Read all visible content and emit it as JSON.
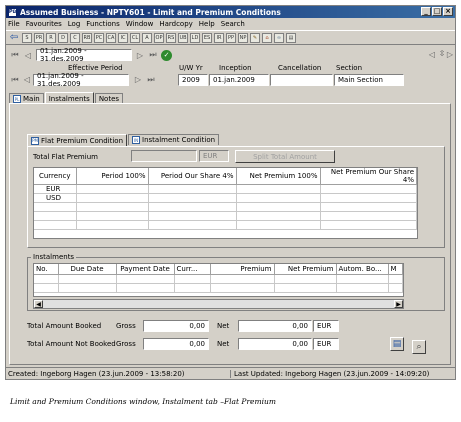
{
  "window": {
    "icon_text": "Pü",
    "title": "Assumed Business - NPTY601 - Limit and Premium Conditions",
    "controls": [
      "_",
      "□",
      "×"
    ]
  },
  "menu": [
    "File",
    "Favourites",
    "Log",
    "Functions",
    "Window",
    "Hardcopy",
    "Help",
    "Search"
  ],
  "toolbar": {
    "buttons": [
      "S",
      "PR",
      "R",
      "D",
      "C",
      "RB",
      "PC",
      "CA",
      "IC",
      "CL",
      "A",
      "OP",
      "RS",
      "UB",
      "LD",
      "ES",
      "IR",
      "PP",
      "NP",
      "",
      "",
      "",
      ""
    ]
  },
  "nav": {
    "period": "01.jan.2009 - 31.des.2009"
  },
  "header": {
    "labels": {
      "effective_period": "Effective Period",
      "uw_yr": "U/W Yr",
      "inception": "Inception",
      "cancellation": "Cancellation",
      "section": "Section"
    },
    "values": {
      "effective_period": "01.jan.2009 - 31.des.2009",
      "uw_yr": "2009",
      "inception": "01.jan.2009",
      "cancellation": "",
      "section": "Main Section"
    }
  },
  "tabs": [
    {
      "icon": "PL",
      "label": "Main"
    },
    {
      "label": "Instalments"
    },
    {
      "label": "Notes"
    }
  ],
  "subtabs": [
    {
      "icon": "PM",
      "label": "Flat Premium Condition"
    },
    {
      "icon": "IN",
      "label": "Instalment Condition"
    }
  ],
  "flat_premium": {
    "total_label": "Total Flat Premium",
    "total_value": "",
    "currency": "EUR",
    "split_button": "Split Total Amount",
    "columns": [
      "Currency",
      "Period 100%",
      "Period Our Share 4%",
      "Net Premium 100%",
      "Net Premium Our Share 4%"
    ],
    "rows": [
      [
        "EUR",
        "",
        "",
        "",
        ""
      ],
      [
        "USD",
        "",
        "",
        "",
        ""
      ],
      [
        "",
        "",
        "",
        "",
        ""
      ],
      [
        "",
        "",
        "",
        "",
        ""
      ],
      [
        "",
        "",
        "",
        "",
        ""
      ]
    ]
  },
  "instalments": {
    "group_label": "Instalments",
    "columns": [
      "No.",
      "Due Date",
      "Payment Date",
      "Curr...",
      "Premium",
      "Net Premium",
      "Autom. Bo...",
      "M"
    ],
    "rows": [
      [
        "",
        "",
        "",
        "",
        "",
        "",
        "",
        ""
      ],
      [
        "",
        "",
        "",
        "",
        "",
        "",
        "",
        ""
      ]
    ]
  },
  "totals": {
    "booked": {
      "label": "Total Amount Booked",
      "gross_label": "Gross",
      "gross": "0,00",
      "net_label": "Net",
      "net": "0,00",
      "currency": "EUR"
    },
    "not_booked": {
      "label": "Total Amount Not Booked",
      "gross_label": "Gross",
      "gross": "0,00",
      "net_label": "Net",
      "net": "0,00",
      "currency": "EUR"
    }
  },
  "status": {
    "created": "Created: Ingeborg Hagen (23.jun.2009 - 13:58:20)",
    "updated": "Last Updated: Ingeborg Hagen (23.jun.2009 - 14:09:20)"
  },
  "caption": "Limit and Premium Conditions window, Instalment tab –Flat Premium"
}
